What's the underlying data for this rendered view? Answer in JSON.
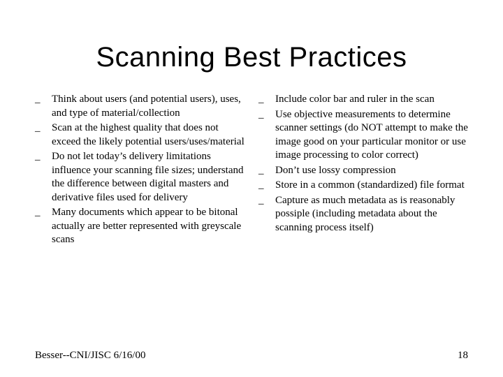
{
  "title": "Scanning Best Practices",
  "bullet_marker": "_",
  "left": [
    "Think about users (and potential users), uses, and type of material/collection",
    "Scan at the highest quality that does not exceed the likely potential users/uses/material",
    "Do not let today’s delivery limitations influence your scanning file sizes; understand the difference between digital masters and derivative files used for delivery",
    "Many documents which appear to be bitonal actually are better represented with greyscale scans"
  ],
  "right": [
    "Include color bar and ruler in the scan",
    "Use objective measurements to determine scanner settings (do NOT attempt to make the image good on your particular monitor or use image processing to color correct)",
    "Don’t use lossy compression",
    "Store in a common (standardized) file format",
    "Capture as much metadata as is reasonably possiple (including metadata about the scanning process itself)"
  ],
  "footer_left": "Besser--CNI/JISC   6/16/00",
  "footer_right": "18"
}
